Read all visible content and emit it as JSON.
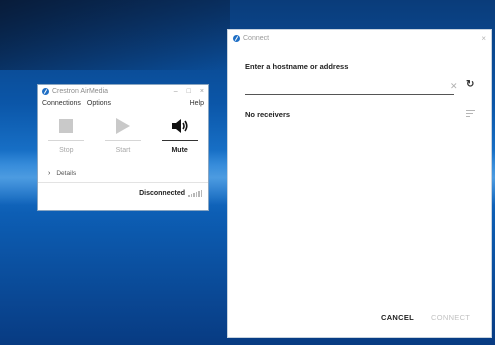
{
  "airmedia": {
    "title": "Crestron AirMedia",
    "window_controls": [
      "–",
      "□",
      "×"
    ],
    "menu": {
      "connections": "Connections",
      "options": "Options",
      "help": "Help"
    },
    "buttons": [
      {
        "id": "stop",
        "label": "Stop",
        "icon": "stop-icon",
        "enabled": false
      },
      {
        "id": "start",
        "label": "Start",
        "icon": "play-icon",
        "enabled": false
      },
      {
        "id": "mute",
        "label": "Mute",
        "icon": "speaker-icon",
        "enabled": true
      }
    ],
    "details_label": "Details",
    "status": "Disconnected"
  },
  "connect": {
    "title": "Connect",
    "close": "×",
    "prompt": "Enter a hostname or address",
    "input_value": "",
    "receivers_label": "No receivers",
    "cancel_label": "CANCEL",
    "connect_label": "CONNECT"
  },
  "colors": {
    "brand_blue": "#1f6fc5",
    "disabled_gray": "#c9c9c9",
    "text_dark": "#222222"
  }
}
